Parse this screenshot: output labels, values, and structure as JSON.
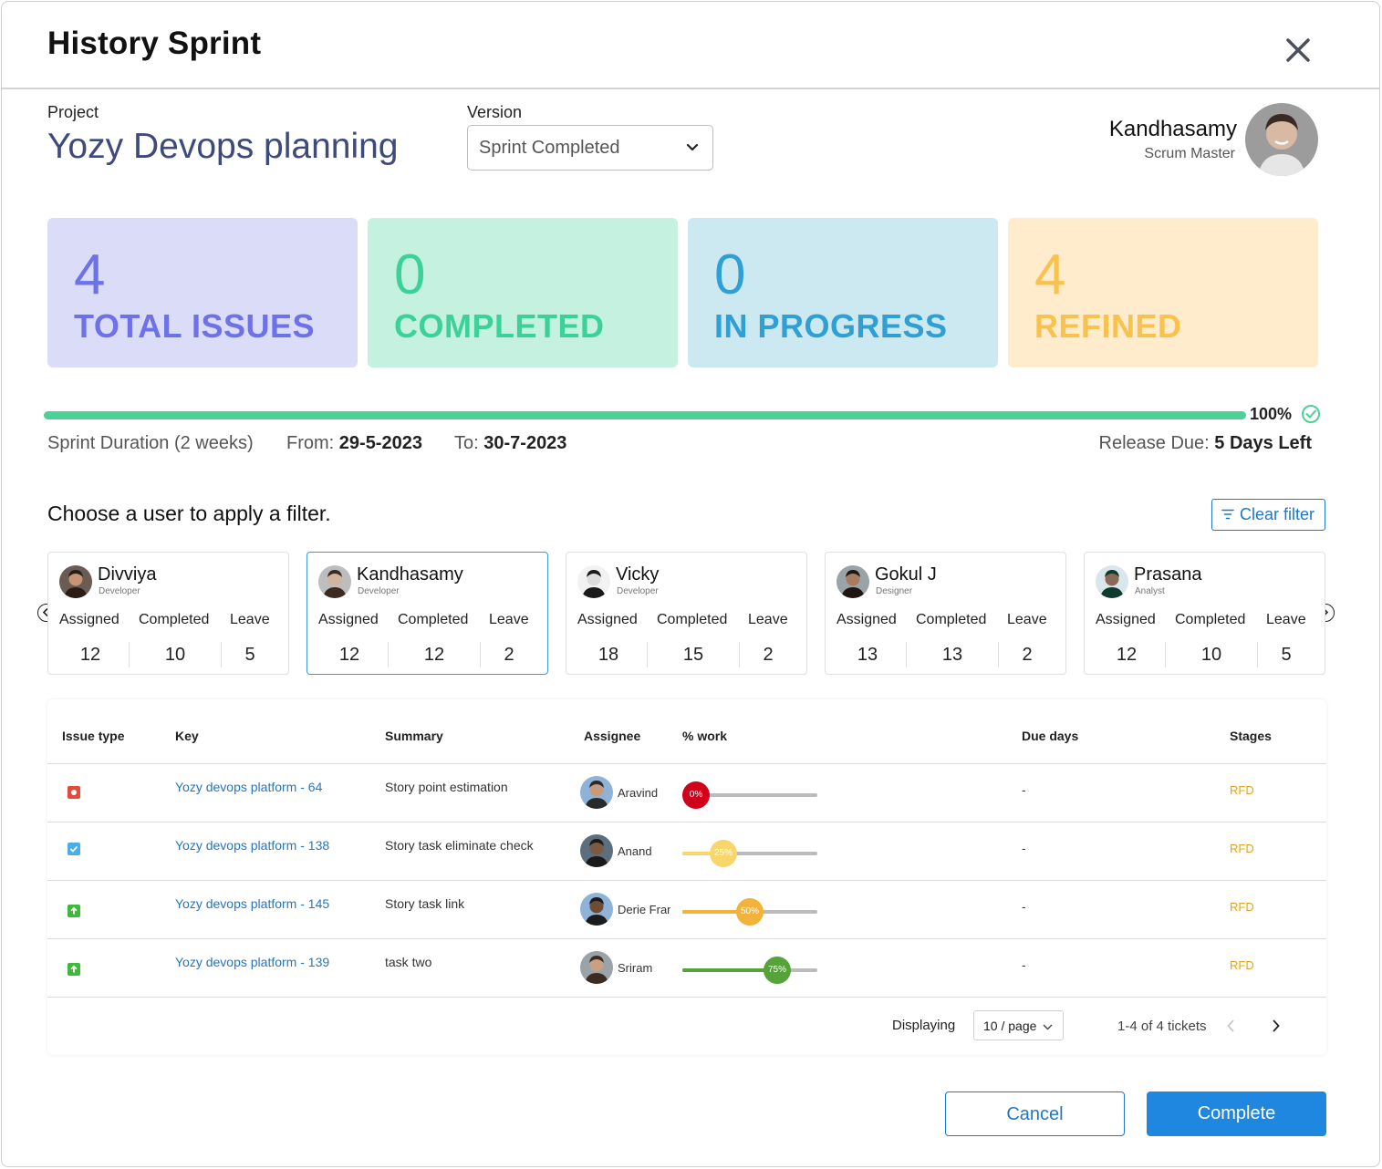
{
  "header": {
    "title": "History Sprint"
  },
  "project": {
    "label": "Project",
    "name": "Yozy Devops planning"
  },
  "version": {
    "label": "Version",
    "selected": "Sprint Completed"
  },
  "current_user": {
    "name": "Kandhasamy",
    "role": "Scrum Master"
  },
  "stats": [
    {
      "value": "4",
      "label": "TOTAL  ISSUES",
      "color": "#6e72e8",
      "bg": "#dadcf8"
    },
    {
      "value": "0",
      "label": "COMPLETED",
      "color": "#3dd19a",
      "bg": "#c4f1e0"
    },
    {
      "value": "0",
      "label": "IN PROGRESS",
      "color": "#2f9fd4",
      "bg": "#cce9f2"
    },
    {
      "value": "4",
      "label": "REFINED",
      "color": "#f9c14d",
      "bg": "#feeccc"
    }
  ],
  "progress": {
    "percent": "100%",
    "value": 100,
    "color": "#4cd197"
  },
  "sprint": {
    "duration": "Sprint Duration (2 weeks)",
    "from_label": "From:",
    "from": "29-5-2023",
    "to_label": "To:",
    "to": "30-7-2023",
    "release_label": "Release Due:",
    "release": "5 Days Left"
  },
  "filter": {
    "prompt": "Choose a user to apply a filter.",
    "clear_label": "Clear filter"
  },
  "user_cards": [
    {
      "name": "Divviya",
      "role": "Developer",
      "assigned": "12",
      "completed": "10",
      "leave": "5"
    },
    {
      "name": "Kandhasamy",
      "role": "Developer",
      "assigned": "12",
      "completed": "12",
      "leave": "2"
    },
    {
      "name": "Vicky",
      "role": "Developer",
      "assigned": "18",
      "completed": "15",
      "leave": "2"
    },
    {
      "name": "Gokul J",
      "role": "Designer",
      "assigned": "13",
      "completed": "13",
      "leave": "2"
    },
    {
      "name": "Prasana",
      "role": "Analyst",
      "assigned": "12",
      "completed": "10",
      "leave": "5"
    }
  ],
  "card_headers": {
    "assigned": "Assigned",
    "completed": "Completed",
    "leave": "Leave"
  },
  "table": {
    "columns": [
      "Issue type",
      "Key",
      "Summary",
      "Assignee",
      "% work",
      "Due days",
      "Stages"
    ],
    "rows": [
      {
        "type": "bug-icon",
        "key": "Yozy devops platform - 64",
        "summary": "Story point estimation",
        "assignee": "Aravind",
        "work": "0%",
        "work_value": 0,
        "work_color": "#d0021b",
        "due": "-",
        "stage": "RFD"
      },
      {
        "type": "task-icon",
        "key": "Yozy devops platform - 138",
        "summary": "Story task eliminate check",
        "assignee": "Anand",
        "work": "25%",
        "work_value": 25,
        "work_color": "#f8d66b",
        "due": "-",
        "stage": "RFD"
      },
      {
        "type": "story-icon",
        "key": "Yozy devops platform - 145",
        "summary": "Story task link",
        "assignee": "Derie Franklin",
        "work": "50%",
        "work_value": 50,
        "work_color": "#f2b33a",
        "due": "-",
        "stage": "RFD"
      },
      {
        "type": "story-icon",
        "key": "Yozy devops platform - 139",
        "summary": "task two",
        "assignee": "Sriram",
        "work": "75%",
        "work_value": 75,
        "work_color": "#56a33a",
        "due": "-",
        "stage": "RFD"
      }
    ]
  },
  "pagination": {
    "label": "Displaying",
    "page_size": "10 / page",
    "count": "1-4 of 4 tickets"
  },
  "footer": {
    "cancel": "Cancel",
    "complete": "Complete"
  }
}
